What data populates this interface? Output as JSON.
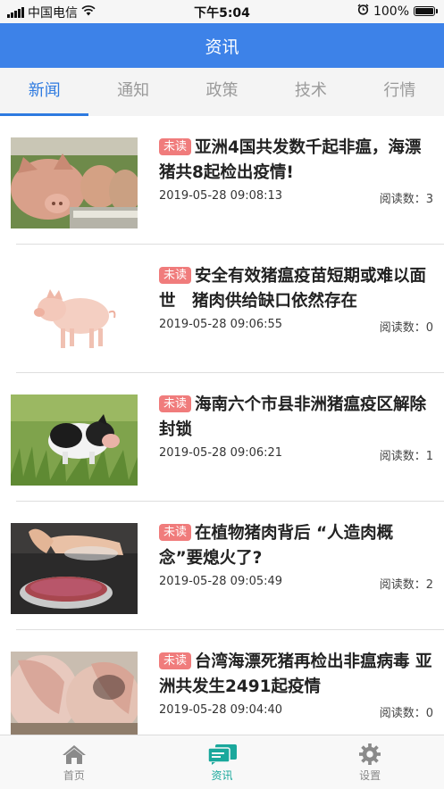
{
  "status_bar": {
    "carrier": "中国电信",
    "time": "下午5:04",
    "battery": "100%"
  },
  "header": {
    "title": "资讯"
  },
  "tabs": [
    {
      "label": "新闻",
      "active": true
    },
    {
      "label": "通知",
      "active": false
    },
    {
      "label": "政策",
      "active": false
    },
    {
      "label": "技术",
      "active": false
    },
    {
      "label": "行情",
      "active": false
    }
  ],
  "articles": [
    {
      "badge": "未读",
      "title": "亚洲4国共发数千起非瘟，海漂猪共8起检出疫情!",
      "date": "2019-05-28 09:08:13",
      "reads": "阅读数：3",
      "image": "pigs-at-trough"
    },
    {
      "badge": "未读",
      "title": "安全有效猪瘟疫苗短期或难以面世　猪肉供给缺口依然存在",
      "date": "2019-05-28 09:06:55",
      "reads": "阅读数：0",
      "image": "piglet-on-white"
    },
    {
      "badge": "未读",
      "title": "海南六个市县非洲猪瘟疫区解除封锁",
      "date": "2019-05-28 09:06:21",
      "reads": "阅读数：1",
      "image": "piglet-in-grass"
    },
    {
      "badge": "未读",
      "title": "在植物猪肉背后 “人造肉概念”要熄火了?",
      "date": "2019-05-28 09:05:49",
      "reads": "阅读数：2",
      "image": "lab-meat-petri-dish"
    },
    {
      "badge": "未读",
      "title": "台湾海漂死猪再检出非瘟病毒 亚洲共发生2491起疫情",
      "date": "2019-05-28 09:04:40",
      "reads": "阅读数：0",
      "image": "pig-ears-closeup"
    }
  ],
  "bottom_nav": [
    {
      "label": "首页",
      "icon": "home-icon",
      "active": false
    },
    {
      "label": "资讯",
      "icon": "news-chat-icon",
      "active": true
    },
    {
      "label": "设置",
      "icon": "gear-icon",
      "active": false
    }
  ],
  "colors": {
    "header": "#3d82e8",
    "tab_active": "#2e7ae0",
    "badge": "#f07c7c",
    "nav_active": "#1aa89c"
  }
}
